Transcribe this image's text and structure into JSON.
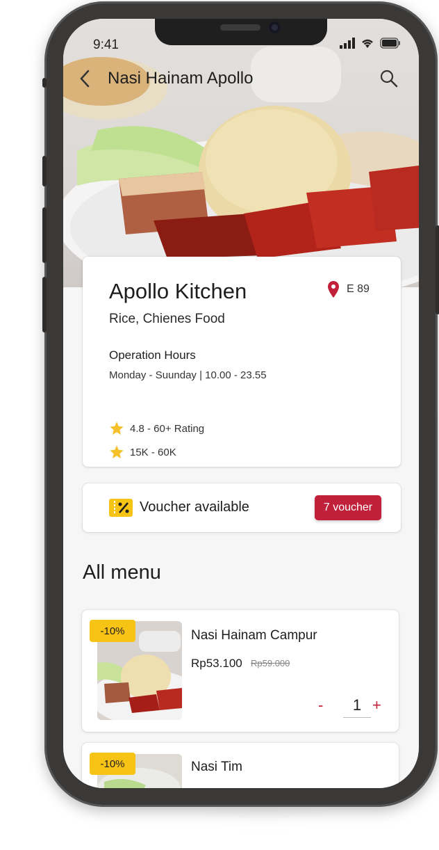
{
  "status": {
    "time": "9:41"
  },
  "topbar": {
    "title": "Nasi Hainam Apollo"
  },
  "restaurant": {
    "name": "Apollo Kitchen",
    "cuisine": "Rice, Chienes Food",
    "location_code": "E 89",
    "hours_title": "Operation Hours",
    "hours_value": "Monday - Suunday | 10.00 - 23.55",
    "rating": "4.8 - 60+ Rating",
    "price_range": "15K - 60K"
  },
  "voucher": {
    "text": "Voucher available",
    "button_label": "7 voucher"
  },
  "menu": {
    "section_title": "All menu",
    "items": [
      {
        "name": "Nasi Hainam Campur",
        "discount": "-10%",
        "price": "Rp53.100",
        "old_price": "Rp59.000",
        "quantity": "1",
        "minus_label": "-",
        "plus_label": "+"
      },
      {
        "name": "Nasi Tim",
        "discount": "-10%"
      }
    ]
  },
  "colors": {
    "accent": "#c0203a",
    "badge": "#f7c315",
    "star": "#f5c02a"
  }
}
